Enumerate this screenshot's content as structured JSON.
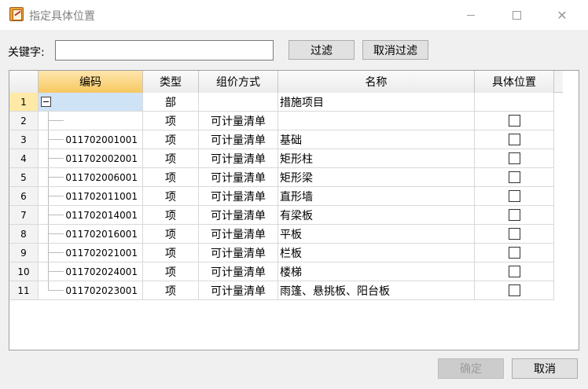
{
  "window": {
    "title": "指定具体位置",
    "icon": "app-icon"
  },
  "filter": {
    "label": "关键字:",
    "value": "",
    "placeholder": "",
    "filter_button": "过滤",
    "clear_button": "取消过滤"
  },
  "grid": {
    "columns": [
      "",
      "编码",
      "类型",
      "组价方式",
      "名称",
      "具体位置"
    ],
    "rows": [
      {
        "num": "1",
        "code": "",
        "type": "部",
        "method": "",
        "name": "措施项目",
        "has_checkbox": false,
        "checked": false
      },
      {
        "num": "2",
        "code": "",
        "type": "项",
        "method": "可计量清单",
        "name": "",
        "has_checkbox": true,
        "checked": false
      },
      {
        "num": "3",
        "code": "011702001001",
        "type": "项",
        "method": "可计量清单",
        "name": "基础",
        "has_checkbox": true,
        "checked": false
      },
      {
        "num": "4",
        "code": "011702002001",
        "type": "项",
        "method": "可计量清单",
        "name": "矩形柱",
        "has_checkbox": true,
        "checked": false
      },
      {
        "num": "5",
        "code": "011702006001",
        "type": "项",
        "method": "可计量清单",
        "name": "矩形梁",
        "has_checkbox": true,
        "checked": false
      },
      {
        "num": "6",
        "code": "011702011001",
        "type": "项",
        "method": "可计量清单",
        "name": "直形墙",
        "has_checkbox": true,
        "checked": false
      },
      {
        "num": "7",
        "code": "011702014001",
        "type": "项",
        "method": "可计量清单",
        "name": "有梁板",
        "has_checkbox": true,
        "checked": false
      },
      {
        "num": "8",
        "code": "011702016001",
        "type": "项",
        "method": "可计量清单",
        "name": "平板",
        "has_checkbox": true,
        "checked": false
      },
      {
        "num": "9",
        "code": "011702021001",
        "type": "项",
        "method": "可计量清单",
        "name": "栏板",
        "has_checkbox": true,
        "checked": false
      },
      {
        "num": "10",
        "code": "011702024001",
        "type": "项",
        "method": "可计量清单",
        "name": "楼梯",
        "has_checkbox": true,
        "checked": false
      },
      {
        "num": "11",
        "code": "011702023001",
        "type": "项",
        "method": "可计量清单",
        "name": "雨篷、悬挑板、阳台板",
        "has_checkbox": true,
        "checked": false
      }
    ]
  },
  "footer": {
    "ok_button": "确定",
    "cancel_button": "取消"
  },
  "colors": {
    "active_header": "#f6c860",
    "selected_cell": "#cfe3f7",
    "selected_row_number": "#ffe9a6"
  }
}
